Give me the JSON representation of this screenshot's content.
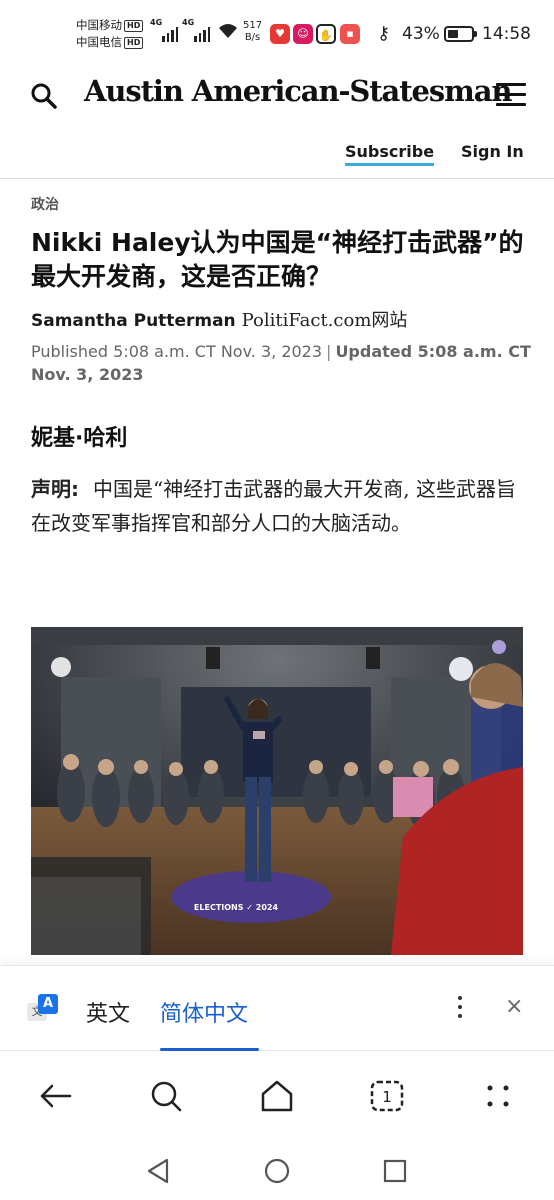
{
  "status_bar": {
    "carrier_1": "中国移动",
    "carrier_2": "中国电信",
    "hd_badge": "HD",
    "network_1": "4G",
    "network_2": "4G",
    "speed_value": "517",
    "speed_unit": "B/s",
    "battery_percent": "43%",
    "battery_level": 0.43,
    "time": "14:58"
  },
  "header": {
    "site_title": "Austin American-Statesman",
    "subscribe_label": "Subscribe",
    "signin_label": "Sign In"
  },
  "article": {
    "category": "政治",
    "headline": "Nikki Haley认为中国是“神经打击武器”的最大开发商，这是否正确？",
    "author": "Samantha Putterman",
    "source": "PolitiFact.com网站",
    "published": "Published 5:08 a.m. CT Nov. 3, 2023",
    "separator": "|",
    "updated": "Updated 5:08 a.m. CT Nov. 3, 2023",
    "speaker": "妮基·哈利",
    "claim_label": "声明:",
    "claim_text": "中国是“神经打击武器的最大开发商, 这些武器旨在改变军事指挥官和部分人口的大脑活动。",
    "photo_stage_text": "ELECTIONS ✓ 2024"
  },
  "translate_bar": {
    "icon_back": "文",
    "icon_front": "A",
    "tab_source": "英文",
    "tab_target": "简体中文",
    "active_tab": "简体中文",
    "close_glyph": "×"
  },
  "toolbar": {
    "tab_count": "1"
  },
  "colors": {
    "accent_link": "#3fa9de",
    "translate_active": "#1a5fd0"
  }
}
